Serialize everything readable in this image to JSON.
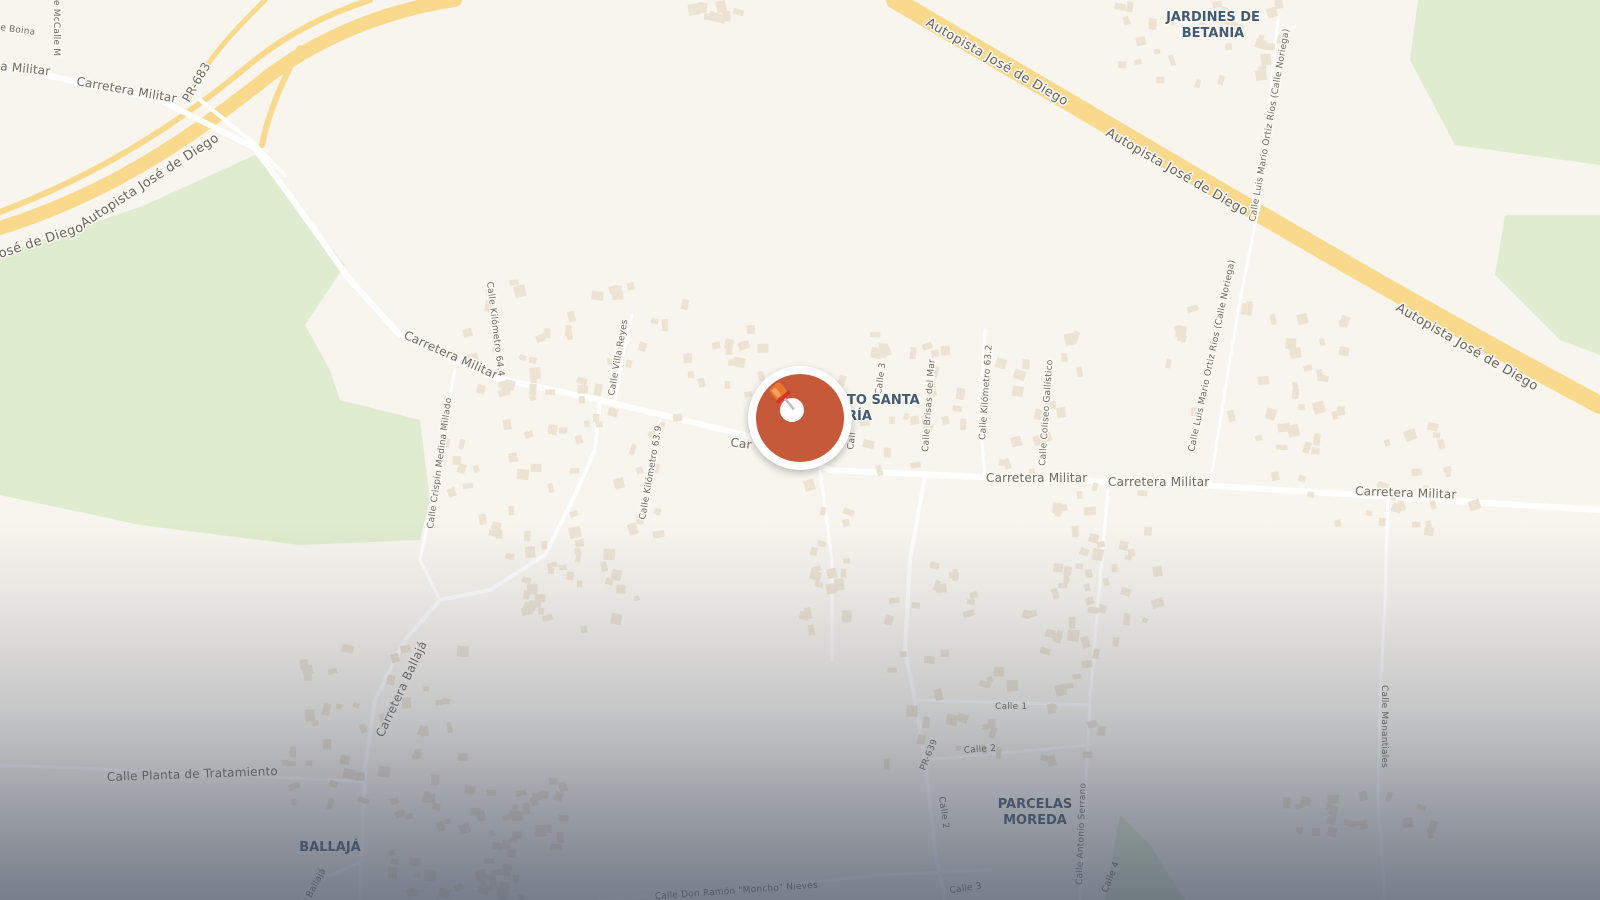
{
  "map": {
    "highways": {
      "autopista_nw": "Autopista José de Diego",
      "autopista_nw_edge": "osé de Diego",
      "autopista_ne_1": "Autopista José de Diego",
      "autopista_ne_2": "Autopista José de Diego",
      "autopista_ne_3": "Autopista José de Diego"
    },
    "streets": {
      "carretera_militar_nw1": "a Militar",
      "carretera_militar_nw2": "Carretera Militar",
      "carretera_militar_w": "Carretera Militar",
      "carretera_militar_cut": "Car",
      "carretera_militar_e1": "Carretera Militar",
      "carretera_militar_e2": "Carretera Militar",
      "carretera_militar_e3": "Carretera Militar",
      "pr683": "PR-683",
      "pr639": "PR-639",
      "calle_boina": "e Boina",
      "calle_mcalle": "e McCalle M",
      "calle_km644": "Calle Kilómetro 64.4",
      "calle_villa_reyes": "Calle Villa Reyes",
      "calle_km639": "Calle Kilómetro 63.9",
      "calle_crispin": "Calle Crispín Medina Millado",
      "calle_3": "Calle 3",
      "calle_brisas": "Calle Brisas del Mar",
      "calle_km632": "Calle Kilómetro 63.2",
      "calle_coliseo": "Calle Coliseo Gallístico",
      "calle_luis_1": "Calle Luis Mario Ortiz Ríos (Calle Noriega)",
      "calle_luis_2": "Calle Luis Mario Ortiz Ríos (Calle Noriega)",
      "calle_ballaja": "Carretera Ballajá",
      "calle_planta": "Calle Planta de Tratamiento",
      "calle_1": "Calle 1",
      "calle_2": "Calle 2",
      "calle_2v": "Calle 2",
      "calle_3s": "Calle 3",
      "calle_4": "Calle 4",
      "calle_antonio": "Calle Antonio Serrano",
      "calle_manantiales": "Calle Manantiales",
      "calle_don_ramon": "Calle Don Ramón \"Moncho\" Nieves",
      "ballaja_small": "Ballajá",
      "calle_cut": "Call"
    },
    "places": {
      "jardines_1": "JARDINES DE",
      "jardines_2": "BETANIA",
      "santa_1": "TO SANTA",
      "santa_2": "RÍA",
      "parcelas_1": "PARCELAS",
      "parcelas_2": "MOREDA",
      "ballaja": "BALLAJÁ"
    },
    "colors": {
      "background": "#f8f5ee",
      "park": "#dfeccf",
      "highway": "#f9d98b",
      "road": "#ffffff",
      "building": "#ece3d3",
      "marker": "#c65a38"
    },
    "marker": {
      "icon": "push-pin-icon"
    }
  }
}
